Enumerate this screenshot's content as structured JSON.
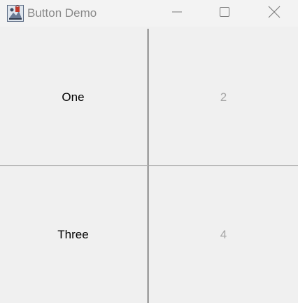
{
  "window": {
    "title": "Button Demo",
    "icon": "java-app-icon",
    "controls": {
      "minimize": "minimize-icon",
      "maximize": "maximize-icon",
      "close": "close-icon"
    }
  },
  "buttons": [
    {
      "label": "One",
      "enabled": true
    },
    {
      "label": "2",
      "enabled": false
    },
    {
      "label": "Three",
      "enabled": true
    },
    {
      "label": "4",
      "enabled": false
    }
  ],
  "colors": {
    "enabled_text": "#000000",
    "disabled_text": "#a6a6a6",
    "button_face": "#f0f0f0",
    "button_border": "#8d8d8d"
  }
}
